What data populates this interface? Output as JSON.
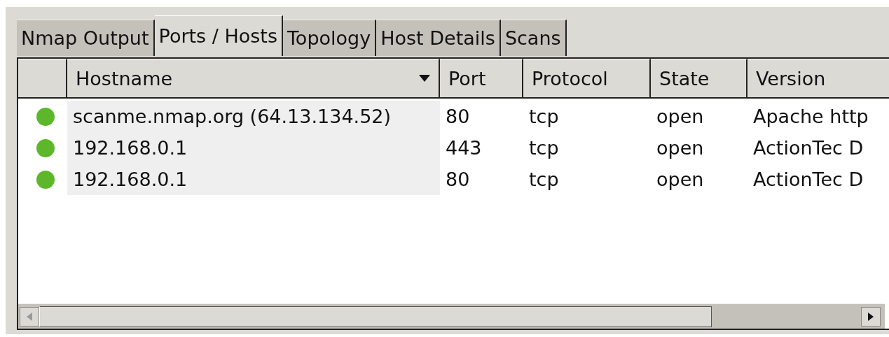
{
  "tabs": [
    {
      "label": "Nmap Output",
      "selected": false
    },
    {
      "label": "Ports / Hosts",
      "selected": true
    },
    {
      "label": "Topology",
      "selected": false
    },
    {
      "label": "Host Details",
      "selected": false
    },
    {
      "label": "Scans",
      "selected": false
    }
  ],
  "table": {
    "columns": [
      {
        "label": "Hostname",
        "sorted": true
      },
      {
        "label": "Port",
        "sorted": false
      },
      {
        "label": "Protocol",
        "sorted": false
      },
      {
        "label": "State",
        "sorted": false
      },
      {
        "label": "Version",
        "sorted": false
      }
    ],
    "rows": [
      {
        "color": "#5cb82a",
        "cells": [
          "scanme.nmap.org (64.13.134.52)",
          "80",
          "tcp",
          "open",
          "Apache http"
        ]
      },
      {
        "color": "#5cb82a",
        "cells": [
          "192.168.0.1",
          "443",
          "tcp",
          "open",
          "ActionTec D"
        ]
      },
      {
        "color": "#5cb82a",
        "cells": [
          "192.168.0.1",
          "80",
          "tcp",
          "open",
          "ActionTec D"
        ]
      }
    ]
  }
}
